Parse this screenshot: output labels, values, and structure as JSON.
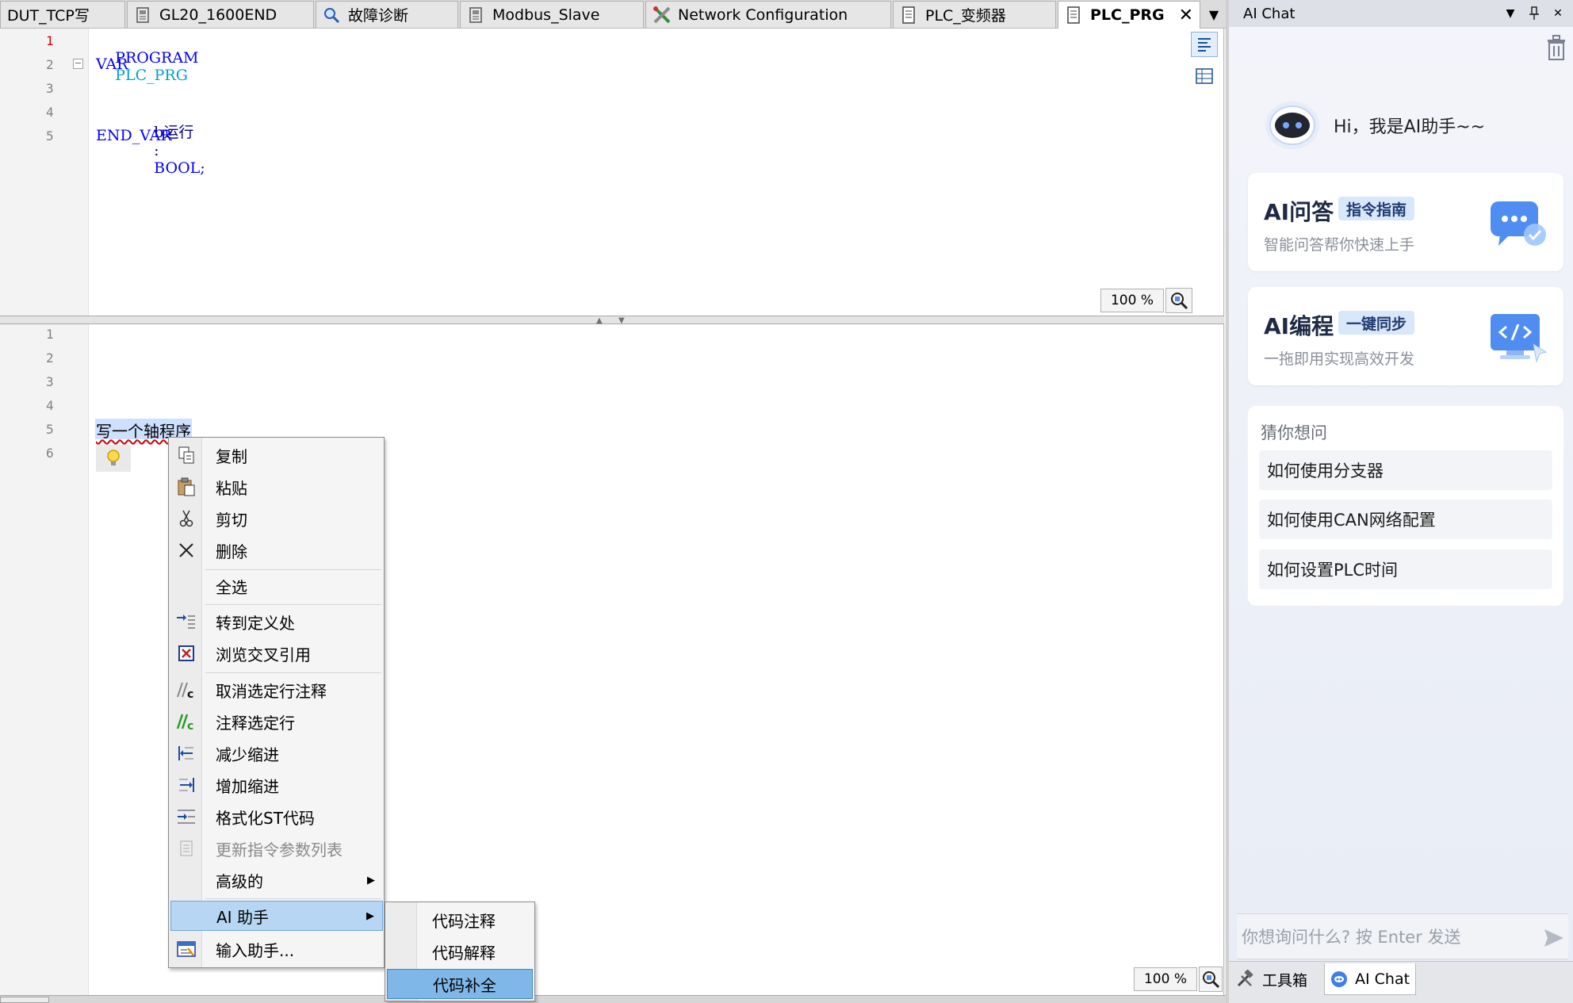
{
  "tabs": [
    {
      "label": "DUT_TCP写",
      "icon": "none"
    },
    {
      "label": "GL20_1600END",
      "icon": "device-icon"
    },
    {
      "label": "故障诊断",
      "icon": "magnifier-icon"
    },
    {
      "label": "Modbus_Slave",
      "icon": "device-icon"
    },
    {
      "label": "Network Configuration",
      "icon": "tools-icon"
    },
    {
      "label": "PLC_变频器",
      "icon": "document-icon"
    },
    {
      "label": "PLC_PRG",
      "icon": "document-icon",
      "active": true
    }
  ],
  "close_glyph": "✕",
  "overflow_glyph": "▼",
  "decl_editor": {
    "line_numbers": [
      "1",
      "2",
      "3",
      "4",
      "5"
    ],
    "lines": {
      "program_kw": "PROGRAM",
      "program_name": "PLC_PRG",
      "var_kw": "VAR",
      "var_name": "b运行",
      "colon": ":",
      "var_type": "BOOL;",
      "end_var_kw": "END_VAR"
    },
    "zoom": "100 %"
  },
  "impl_editor": {
    "line_numbers": [
      "1",
      "2",
      "3",
      "4",
      "5",
      "6"
    ],
    "selected_text": "写一个轴程序",
    "zoom": "100 %"
  },
  "context_menu": {
    "items": [
      {
        "label": "复制",
        "icon": "copy-icon"
      },
      {
        "label": "粘贴",
        "icon": "paste-icon"
      },
      {
        "label": "剪切",
        "icon": "scissors-icon"
      },
      {
        "label": "删除",
        "icon": "delete-x-icon"
      },
      {
        "label": "全选",
        "icon": "none"
      },
      {
        "label": "转到定义处",
        "icon": "goto-definition-icon"
      },
      {
        "label": "浏览交叉引用",
        "icon": "cross-reference-icon"
      },
      {
        "label": "取消选定行注释",
        "icon": "uncomment-icon"
      },
      {
        "label": "注释选定行",
        "icon": "comment-icon"
      },
      {
        "label": "减少缩进",
        "icon": "outdent-icon"
      },
      {
        "label": "增加缩进",
        "icon": "indent-icon"
      },
      {
        "label": "格式化ST代码",
        "icon": "format-code-icon"
      },
      {
        "label": "更新指令参数列表",
        "icon": "update-params-icon",
        "disabled": true
      },
      {
        "label": "高级的",
        "icon": "none",
        "submenu": true
      },
      {
        "label": "AI 助手",
        "icon": "none",
        "submenu": true,
        "highlighted": true
      },
      {
        "label": "输入助手...",
        "icon": "input-assistant-icon"
      }
    ],
    "submenu_arrow": "▶"
  },
  "ai_submenu": {
    "items": [
      {
        "label": "代码注释"
      },
      {
        "label": "代码解释"
      },
      {
        "label": "代码补全",
        "highlighted": true
      }
    ]
  },
  "ai_panel": {
    "title": "AI Chat",
    "greeting": "Hi，我是AI助手~~",
    "cards": [
      {
        "title": "AI问答",
        "badge": "指令指南",
        "subtitle": "智能问答帮你快速上手",
        "icon": "chat-bubble-icon"
      },
      {
        "title": "AI编程",
        "badge": "一键同步",
        "subtitle": "一拖即用实现高效开发",
        "icon": "code-monitor-icon"
      }
    ],
    "suggestions_title": "猜你想问",
    "suggestions": [
      "如何使用分支器",
      "如何使用CAN网络配置",
      "如何设置PLC时间"
    ],
    "input_placeholder": "你想询问什么? 按 Enter 发送",
    "bottom_tabs": [
      {
        "label": "工具箱",
        "icon": "toolbox-icon"
      },
      {
        "label": "AI Chat",
        "icon": "ai-chat-icon",
        "active": true
      }
    ]
  },
  "colors": {
    "keyword": "#0000ff",
    "identifier": "#00a0d0",
    "selection": "#cce0ff",
    "menu_highlight": "#b7d6f3",
    "submenu_highlight": "#7fb7e8",
    "badge_bg": "#d9e7fb"
  }
}
